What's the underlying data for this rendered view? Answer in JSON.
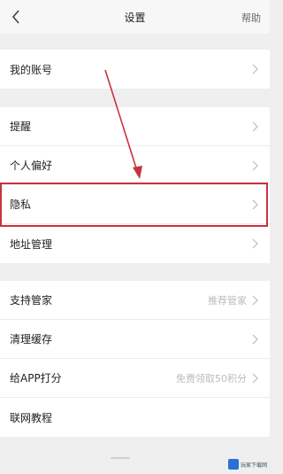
{
  "header": {
    "title": "设置",
    "help_label": "帮助"
  },
  "sections": [
    {
      "items": [
        {
          "label": "我的账号"
        }
      ]
    },
    {
      "items": [
        {
          "label": "提醒"
        },
        {
          "label": "个人偏好"
        },
        {
          "label": "隐私",
          "highlighted": true
        },
        {
          "label": "地址管理"
        }
      ]
    },
    {
      "items": [
        {
          "label": "支持管家",
          "value": "推荐管家"
        },
        {
          "label": "清理缓存"
        },
        {
          "label": "给APP打分",
          "value": "免费领取50积分"
        },
        {
          "label": "联网教程"
        }
      ]
    }
  ],
  "annotation": {
    "color": "#c8333e"
  },
  "watermark": {
    "text": "玩家下载网"
  }
}
